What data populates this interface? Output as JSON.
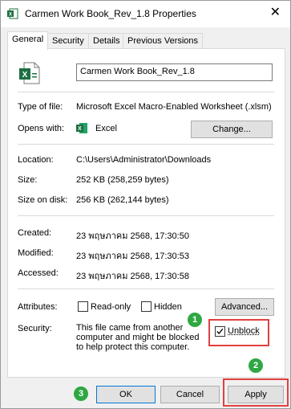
{
  "window": {
    "title": "Carmen Work Book_Rev_1.8 Properties",
    "close_glyph": "✕"
  },
  "tabs": [
    "General",
    "Security",
    "Details",
    "Previous Versions"
  ],
  "general": {
    "file_name": "Carmen Work Book_Rev_1.8",
    "type_label": "Type of file:",
    "type_value": "Microsoft Excel Macro-Enabled Worksheet (.xlsm)",
    "opens_label": "Opens with:",
    "opens_value": "Excel",
    "change_button": "Change...",
    "location_label": "Location:",
    "location_value": "C:\\Users\\Administrator\\Downloads",
    "size_label": "Size:",
    "size_value": "252 KB (258,259 bytes)",
    "size_disk_label": "Size on disk:",
    "size_disk_value": "256 KB (262,144 bytes)",
    "created_label": "Created:",
    "created_value": "23 พฤษภาคม 2568, 17:30:50",
    "modified_label": "Modified:",
    "modified_value": "23 พฤษภาคม 2568, 17:30:53",
    "accessed_label": "Accessed:",
    "accessed_value": "23 พฤษภาคม 2568, 17:30:58",
    "attributes_label": "Attributes:",
    "readonly_label": "Read-only",
    "hidden_label": "Hidden",
    "advanced_button": "Advanced...",
    "security_label": "Security:",
    "security_text": "This file came from another computer and might be blocked to help protect this computer.",
    "unblock_label": "Unblock",
    "unblock_checked": true
  },
  "footer": {
    "ok_button": "OK",
    "cancel_button": "Cancel",
    "apply_button": "Apply"
  },
  "annotations": {
    "step1": "1",
    "step2": "2",
    "step3": "3",
    "badge_color": "#2fa843",
    "highlight_color": "#e14040"
  },
  "colors": {
    "excel_green": "#1d6f42"
  }
}
